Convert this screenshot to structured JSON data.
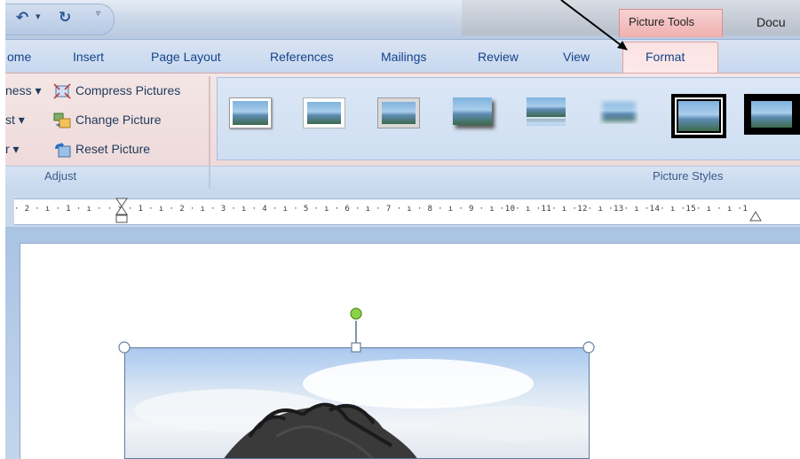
{
  "titlebar": {
    "picture_tools": "Picture Tools",
    "document_title": "Docu",
    "undo_icon": "undo-arrow-icon",
    "redo_icon": "redo-arrow-icon",
    "customize_icon": "qat-customize-icon"
  },
  "tabs": {
    "home": "ome",
    "insert": "Insert",
    "page_layout": "Page Layout",
    "references": "References",
    "mailings": "Mailings",
    "review": "Review",
    "view": "View",
    "format": "Format"
  },
  "adjust_group": {
    "label": "Adjust",
    "brightness": "ness",
    "contrast": "st",
    "recolor": "r",
    "compress_pictures": "Compress Pictures",
    "change_picture": "Change Picture",
    "reset_picture": "Reset Picture"
  },
  "picture_styles": {
    "label": "Picture Styles",
    "count": 8
  },
  "ruler": {
    "text": "· 2 · ı · 1 · ı ·  · ı · 1 · ı · 2 · ı · 3 · ı · 4 · ı · 5 · ı · 6 · ı · 7 · ı · 8 · ı · 9 · ı ·10· ı ·11· ı ·12· ı ·13· ı ·14· ı ·15· ı  · ı ·1"
  },
  "colors": {
    "contextual_tab": "#f0b0b0",
    "ribbon_blue": "#cfdef2",
    "tab_text": "#15428b",
    "rotation_handle": "#8bd24a"
  }
}
